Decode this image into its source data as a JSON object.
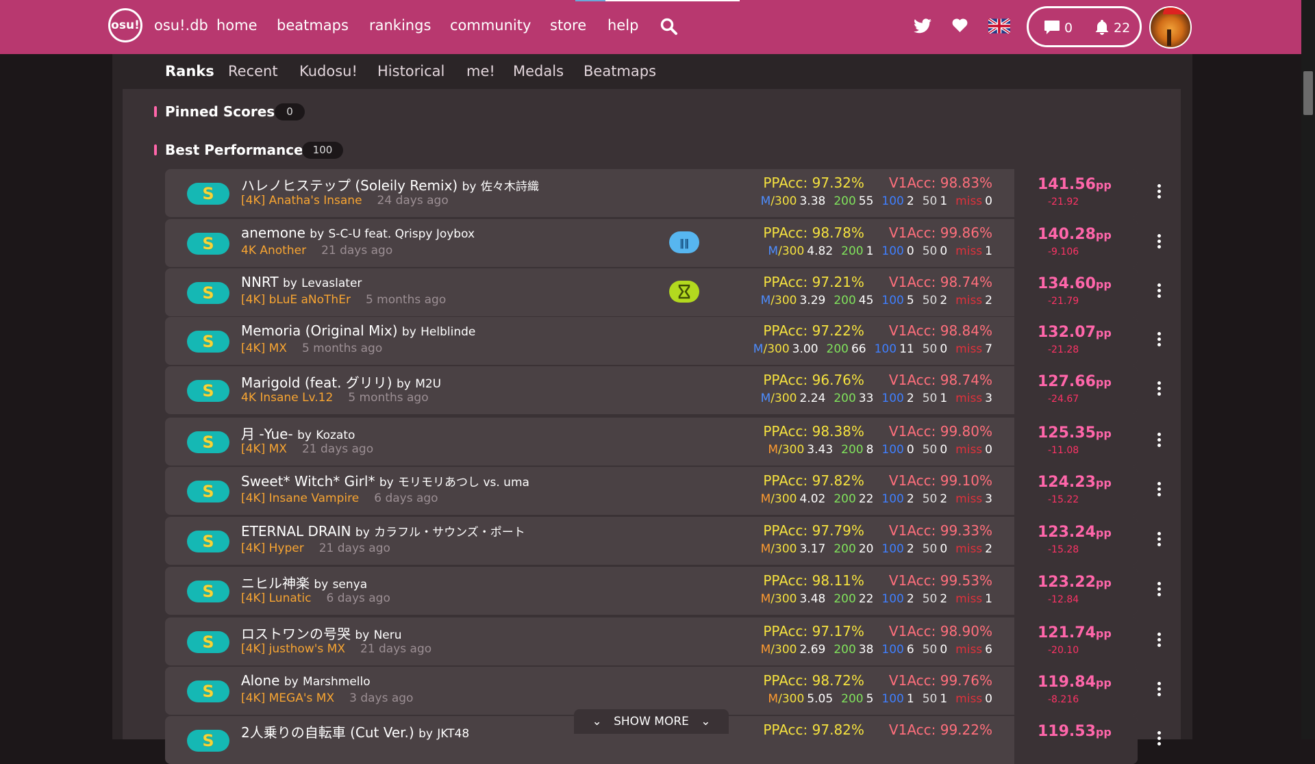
{
  "nav": {
    "logo": "osu!",
    "links": [
      {
        "id": "osudb",
        "label": "osu!.db"
      },
      {
        "id": "home",
        "label": "home"
      },
      {
        "id": "beatmaps",
        "label": "beatmaps"
      },
      {
        "id": "rankings",
        "label": "rankings"
      },
      {
        "id": "community",
        "label": "community"
      },
      {
        "id": "store",
        "label": "store"
      },
      {
        "id": "help",
        "label": "help"
      }
    ],
    "chat_count": "0",
    "notification_count": "22"
  },
  "tabs": [
    "Ranks",
    "Recent",
    "Kudosu!",
    "Historical",
    "me!",
    "Medals",
    "Beatmaps"
  ],
  "sections": {
    "pinned": {
      "title": "Pinned Scores",
      "count": "0"
    },
    "best": {
      "title": "Best Performance",
      "count": "100"
    }
  },
  "colors": {
    "nav": "#b8386f",
    "accent": "#ff66aa",
    "rank_badge": "#15b8b4"
  },
  "scores": [
    {
      "rank": "S",
      "title": "ハレノヒステップ (Soleily Remix)",
      "by": "by",
      "artist": "佐々木詩織",
      "diff": "[4K] Anatha's Insane",
      "ago": "24 days ago",
      "mod": "",
      "ppacc": "PPAcc: 97.32%",
      "v1acc": "V1Acc: 98.83%",
      "m": "M",
      "s300": "/300",
      "r300": "3.38",
      "n200": "55",
      "n100": "2",
      "n50": "1",
      "nmiss": "0",
      "pp": "141.56",
      "ppunit": "pp",
      "ppdiff": "-21.92",
      "morange": false
    },
    {
      "rank": "S",
      "title": "anemone",
      "by": "by",
      "artist": "S-C-U feat. Qrispy Joybox",
      "diff": "4K Another",
      "ago": "21 days ago",
      "mod": "DT",
      "ppacc": "PPAcc: 98.78%",
      "v1acc": "V1Acc: 99.86%",
      "m": "M",
      "s300": "/300",
      "r300": "4.82",
      "n200": "1",
      "n100": "0",
      "n50": "0",
      "nmiss": "1",
      "pp": "140.28",
      "ppunit": "pp",
      "ppdiff": "-9.106",
      "morange": false
    },
    {
      "rank": "S",
      "title": "NNRT",
      "by": "by",
      "artist": "Levaslater",
      "diff": "[4K] bLuE aNoThEr",
      "ago": "5 months ago",
      "mod": "HT",
      "ppacc": "PPAcc: 97.21%",
      "v1acc": "V1Acc: 98.74%",
      "m": "M",
      "s300": "/300",
      "r300": "3.29",
      "n200": "45",
      "n100": "5",
      "n50": "2",
      "nmiss": "2",
      "pp": "134.60",
      "ppunit": "pp",
      "ppdiff": "-21.79",
      "morange": false
    },
    {
      "rank": "S",
      "title": "Memoria (Original Mix)",
      "by": "by",
      "artist": "Helblinde",
      "diff": "[4K] MX",
      "ago": "5 months ago",
      "mod": "",
      "ppacc": "PPAcc: 97.22%",
      "v1acc": "V1Acc: 98.84%",
      "m": "M",
      "s300": "/300",
      "r300": "3.00",
      "n200": "66",
      "n100": "11",
      "n50": "0",
      "nmiss": "7",
      "pp": "132.07",
      "ppunit": "pp",
      "ppdiff": "-21.28",
      "morange": false
    },
    {
      "rank": "S",
      "title": "Marigold (feat. グリリ)",
      "by": "by",
      "artist": "M2U",
      "diff": "4K Insane Lv.12",
      "ago": "5 months ago",
      "mod": "",
      "ppacc": "PPAcc: 96.76%",
      "v1acc": "V1Acc: 98.74%",
      "m": "M",
      "s300": "/300",
      "r300": "2.24",
      "n200": "33",
      "n100": "2",
      "n50": "1",
      "nmiss": "3",
      "pp": "127.66",
      "ppunit": "pp",
      "ppdiff": "-24.67",
      "morange": false
    },
    {
      "rank": "S",
      "title": "月 -Yue-",
      "by": "by",
      "artist": "Kozato",
      "diff": "[4K] MX",
      "ago": "21 days ago",
      "mod": "",
      "ppacc": "PPAcc: 98.38%",
      "v1acc": "V1Acc: 99.80%",
      "m": "M",
      "s300": "/300",
      "r300": "3.43",
      "n200": "8",
      "n100": "0",
      "n50": "0",
      "nmiss": "0",
      "pp": "125.35",
      "ppunit": "pp",
      "ppdiff": "-11.08",
      "morange": true
    },
    {
      "rank": "S",
      "title": "Sweet* Witch* Girl*",
      "by": "by",
      "artist": "モリモリあつし vs. uma",
      "diff": "[4K] Insane Vampire",
      "ago": "6 days ago",
      "mod": "",
      "ppacc": "PPAcc: 97.82%",
      "v1acc": "V1Acc: 99.10%",
      "m": "M",
      "s300": "/300",
      "r300": "4.02",
      "n200": "22",
      "n100": "2",
      "n50": "2",
      "nmiss": "3",
      "pp": "124.23",
      "ppunit": "pp",
      "ppdiff": "-15.22",
      "morange": true
    },
    {
      "rank": "S",
      "title": "ETERNAL DRAIN",
      "by": "by",
      "artist": "カラフル・サウンズ・ポート",
      "diff": "[4K] Hyper",
      "ago": "21 days ago",
      "mod": "",
      "ppacc": "PPAcc: 97.79%",
      "v1acc": "V1Acc: 99.33%",
      "m": "M",
      "s300": "/300",
      "r300": "3.17",
      "n200": "20",
      "n100": "2",
      "n50": "0",
      "nmiss": "2",
      "pp": "123.24",
      "ppunit": "pp",
      "ppdiff": "-15.28",
      "morange": true
    },
    {
      "rank": "S",
      "title": "ニヒル神楽",
      "by": "by",
      "artist": "senya",
      "diff": "[4K] Lunatic",
      "ago": "6 days ago",
      "mod": "",
      "ppacc": "PPAcc: 98.11%",
      "v1acc": "V1Acc: 99.53%",
      "m": "M",
      "s300": "/300",
      "r300": "3.48",
      "n200": "22",
      "n100": "2",
      "n50": "2",
      "nmiss": "1",
      "pp": "123.22",
      "ppunit": "pp",
      "ppdiff": "-12.84",
      "morange": true
    },
    {
      "rank": "S",
      "title": "ロストワンの号哭",
      "by": "by",
      "artist": "Neru",
      "diff": "[4K] justhow's MX",
      "ago": "21 days ago",
      "mod": "",
      "ppacc": "PPAcc: 97.17%",
      "v1acc": "V1Acc: 98.90%",
      "m": "M",
      "s300": "/300",
      "r300": "2.69",
      "n200": "38",
      "n100": "6",
      "n50": "0",
      "nmiss": "6",
      "pp": "121.74",
      "ppunit": "pp",
      "ppdiff": "-20.10",
      "morange": true
    },
    {
      "rank": "S",
      "title": "Alone",
      "by": "by",
      "artist": "Marshmello",
      "diff": "[4K] MEGA's MX",
      "ago": "3 days ago",
      "mod": "",
      "ppacc": "PPAcc: 98.72%",
      "v1acc": "V1Acc: 99.76%",
      "m": "M",
      "s300": "/300",
      "r300": "5.05",
      "n200": "5",
      "n100": "1",
      "n50": "1",
      "nmiss": "0",
      "pp": "119.84",
      "ppunit": "pp",
      "ppdiff": "-8.216",
      "morange": true
    },
    {
      "rank": "S",
      "title": "2人乗りの自転車 (Cut Ver.)",
      "by": "by",
      "artist": "JKT48",
      "diff": "",
      "ago": "",
      "mod": "",
      "ppacc": "PPAcc: 97.82%",
      "v1acc": "V1Acc: 99.22%",
      "m": "",
      "s300": "",
      "r300": "",
      "n200": "",
      "n100": "",
      "n50": "",
      "nmiss": "",
      "pp": "119.53",
      "ppunit": "pp",
      "ppdiff": "",
      "morange": true
    }
  ],
  "labels": {
    "l200": "200",
    "l100": "100",
    "l50": "50",
    "lmiss": "miss",
    "show_more": "SHOW MORE"
  }
}
